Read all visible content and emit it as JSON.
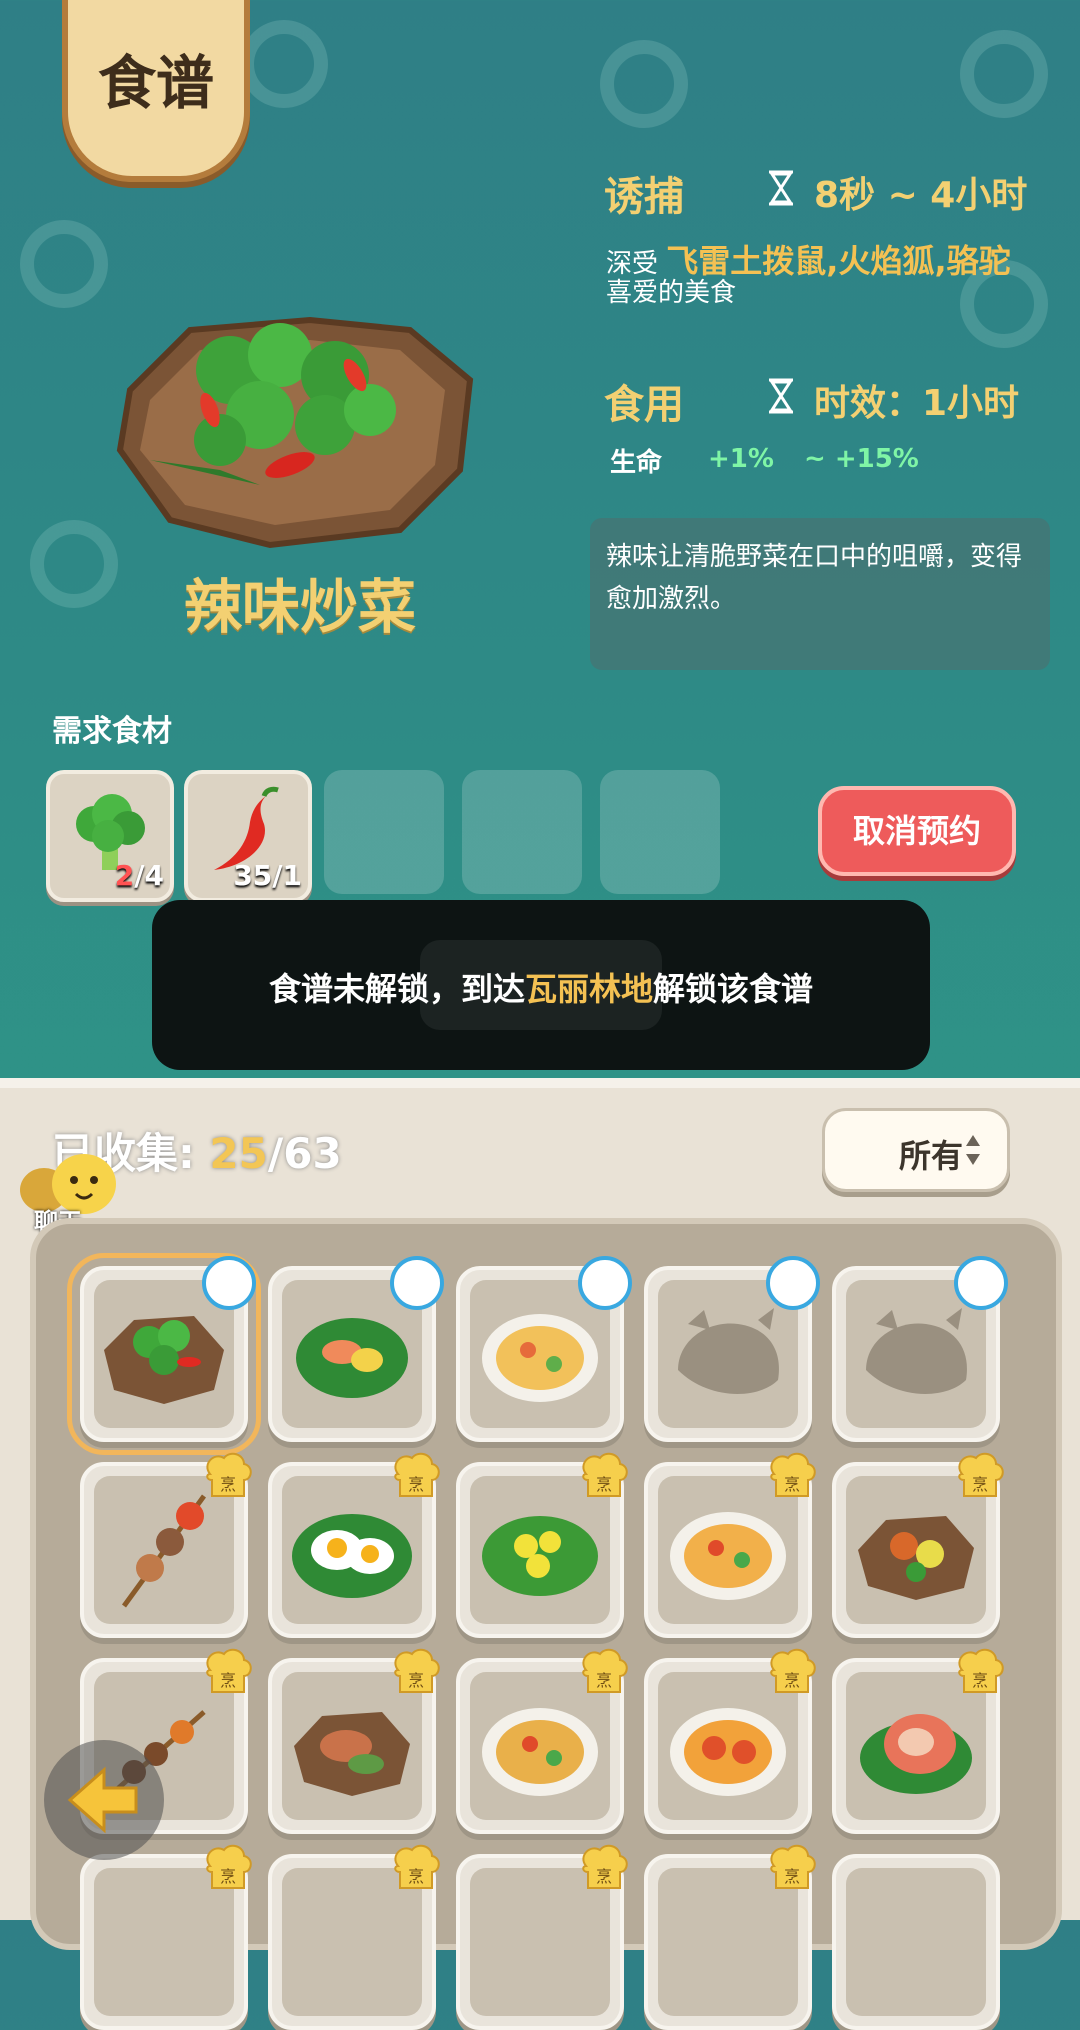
{
  "title": "食谱",
  "dish": {
    "name": "辣味炒菜"
  },
  "lure": {
    "label": "诱捕",
    "time": "8秒 ~ 4小时",
    "pre": "深受",
    "animals": "飞雷土拨鼠,火焰狐,骆驼",
    "post": "喜爱的美食"
  },
  "eat": {
    "label": "食用",
    "duration": "时效：1小时",
    "stat_label": "生命",
    "stat_min": "+1%",
    "stat_max": "~ +15%"
  },
  "description": "辣味让清脆野菜在口中的咀嚼，变得愈加激烈。",
  "ingredients": {
    "label": "需求食材",
    "items": [
      {
        "icon": "broccoli-icon",
        "have": "2",
        "need": "/4"
      },
      {
        "icon": "chili-pepper-icon",
        "have": "35",
        "need": "/1"
      }
    ]
  },
  "cancel_button": "取消预约",
  "toast": {
    "pre": "食谱未解锁，到达",
    "place": "瓦丽林地",
    "post": "解锁该食谱"
  },
  "collection": {
    "label": "已收集: ",
    "current": "25",
    "total": "/63"
  },
  "filter": {
    "value": "所有"
  },
  "chat_label": "聊天",
  "chef_badge": "烹",
  "colors": {
    "accent": "#f3d072",
    "cancel": "#ee5b5b",
    "stat_green": "#7ff5a6"
  }
}
